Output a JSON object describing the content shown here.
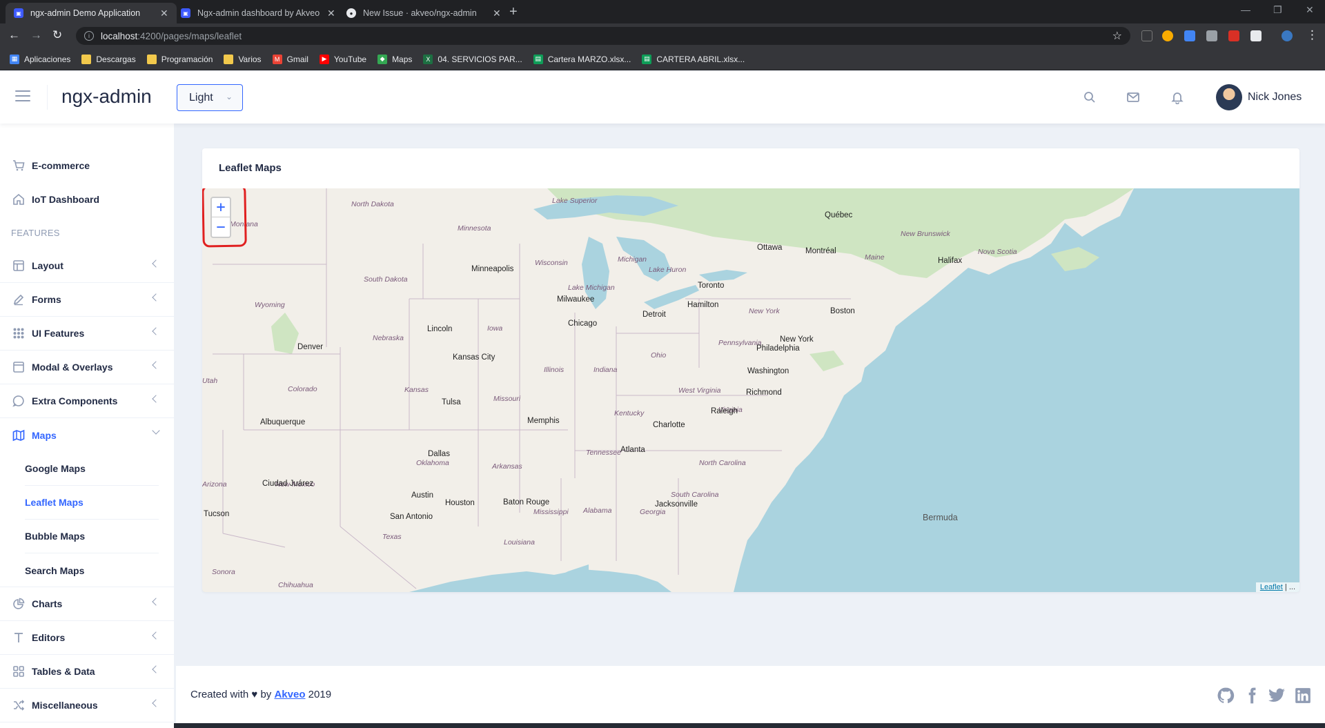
{
  "browser": {
    "tabs": [
      {
        "label": "ngx-admin Demo Application",
        "active": true
      },
      {
        "label": "Ngx-admin dashboard by Akveo",
        "active": false
      },
      {
        "label": "New Issue · akveo/ngx-admin",
        "active": false
      }
    ],
    "url_host": "localhost",
    "url_path": ":4200/pages/maps/leaflet",
    "bookmarks": [
      {
        "label": "Aplicaciones",
        "icon": "apps-grid-icon",
        "color": "#4285f4"
      },
      {
        "label": "Descargas",
        "icon": "folder-icon",
        "color": "#f2c94c"
      },
      {
        "label": "Programación",
        "icon": "folder-icon",
        "color": "#f2c94c"
      },
      {
        "label": "Varios",
        "icon": "folder-icon",
        "color": "#f2c94c"
      },
      {
        "label": "Gmail",
        "icon": "gmail-icon",
        "color": "#ea4335"
      },
      {
        "label": "YouTube",
        "icon": "youtube-icon",
        "color": "#ff0000"
      },
      {
        "label": "Maps",
        "icon": "maps-icon",
        "color": "#34a853"
      },
      {
        "label": "04. SERVICIOS PAR...",
        "icon": "excel-icon",
        "color": "#1d6f42"
      },
      {
        "label": "Cartera MARZO.xlsx...",
        "icon": "sheets-icon",
        "color": "#0f9d58"
      },
      {
        "label": "CARTERA ABRIL.xlsx...",
        "icon": "sheets-icon",
        "color": "#0f9d58"
      }
    ]
  },
  "header": {
    "title": "ngx-admin",
    "theme": "Light",
    "user_name": "Nick Jones"
  },
  "sidebar": {
    "group_label": "FEATURES",
    "top_items": [
      {
        "label": "E-commerce",
        "icon": "shopping-cart-icon"
      },
      {
        "label": "IoT Dashboard",
        "icon": "home-icon"
      }
    ],
    "items": [
      {
        "label": "Layout",
        "icon": "layout-icon"
      },
      {
        "label": "Forms",
        "icon": "edit-icon"
      },
      {
        "label": "UI Features",
        "icon": "keypad-icon"
      },
      {
        "label": "Modal & Overlays",
        "icon": "browser-icon"
      },
      {
        "label": "Extra Components",
        "icon": "message-circle-icon"
      },
      {
        "label": "Maps",
        "icon": "map-icon",
        "expanded": true
      }
    ],
    "sub_items": [
      {
        "label": "Google Maps",
        "active": false
      },
      {
        "label": "Leaflet Maps",
        "active": true
      },
      {
        "label": "Bubble Maps",
        "active": false
      },
      {
        "label": "Search Maps",
        "active": false
      }
    ],
    "bottom_items": [
      {
        "label": "Charts",
        "icon": "pie-chart-icon"
      },
      {
        "label": "Editors",
        "icon": "text-icon"
      },
      {
        "label": "Tables & Data",
        "icon": "grid-icon"
      },
      {
        "label": "Miscellaneous",
        "icon": "shuffle-icon"
      }
    ]
  },
  "card": {
    "title": "Leaflet Maps",
    "zoom_in": "+",
    "zoom_out": "−",
    "attribution_link": "Leaflet",
    "attribution_rest": " | ..."
  },
  "map_labels": {
    "cities": [
      "Minneapolis",
      "Milwaukee",
      "Chicago",
      "Detroit",
      "Toronto",
      "Hamilton",
      "Ottawa",
      "Montréal",
      "Québec",
      "Halifax",
      "Boston",
      "New York",
      "Philadelphia",
      "Washington",
      "Richmond",
      "Raleigh",
      "Charlotte",
      "Atlanta",
      "Jacksonville",
      "Memphis",
      "Kansas City",
      "Lincoln",
      "Denver",
      "Tulsa",
      "Albuquerque",
      "Dallas",
      "Austin",
      "Houston",
      "San Antonio",
      "Baton Rouge",
      "Ciudad Juárez",
      "Tucson",
      "Bermuda"
    ],
    "states": [
      "North Dakota",
      "South Dakota",
      "Minnesota",
      "Wisconsin",
      "Michigan",
      "Iowa",
      "Nebraska",
      "Wyoming",
      "Colorado",
      "Kansas",
      "Missouri",
      "Illinois",
      "Indiana",
      "Ohio",
      "Pennsylvania",
      "New York",
      "West Virginia",
      "Virginia",
      "Kentucky",
      "Tennessee",
      "North Carolina",
      "South Carolina",
      "Georgia",
      "Alabama",
      "Mississippi",
      "Arkansas",
      "Oklahoma",
      "Texas",
      "Louisiana",
      "New Mexico",
      "Maine",
      "New Brunswick",
      "Nova Scotia",
      "Lake Superior",
      "Lake Michigan",
      "Lake Huron",
      "Montana",
      "Utah",
      "Arizona",
      "Sonora",
      "Chihuahua"
    ]
  },
  "footer": {
    "prefix": "Created with ♥ by ",
    "link": "Akveo",
    "year": " 2019"
  }
}
